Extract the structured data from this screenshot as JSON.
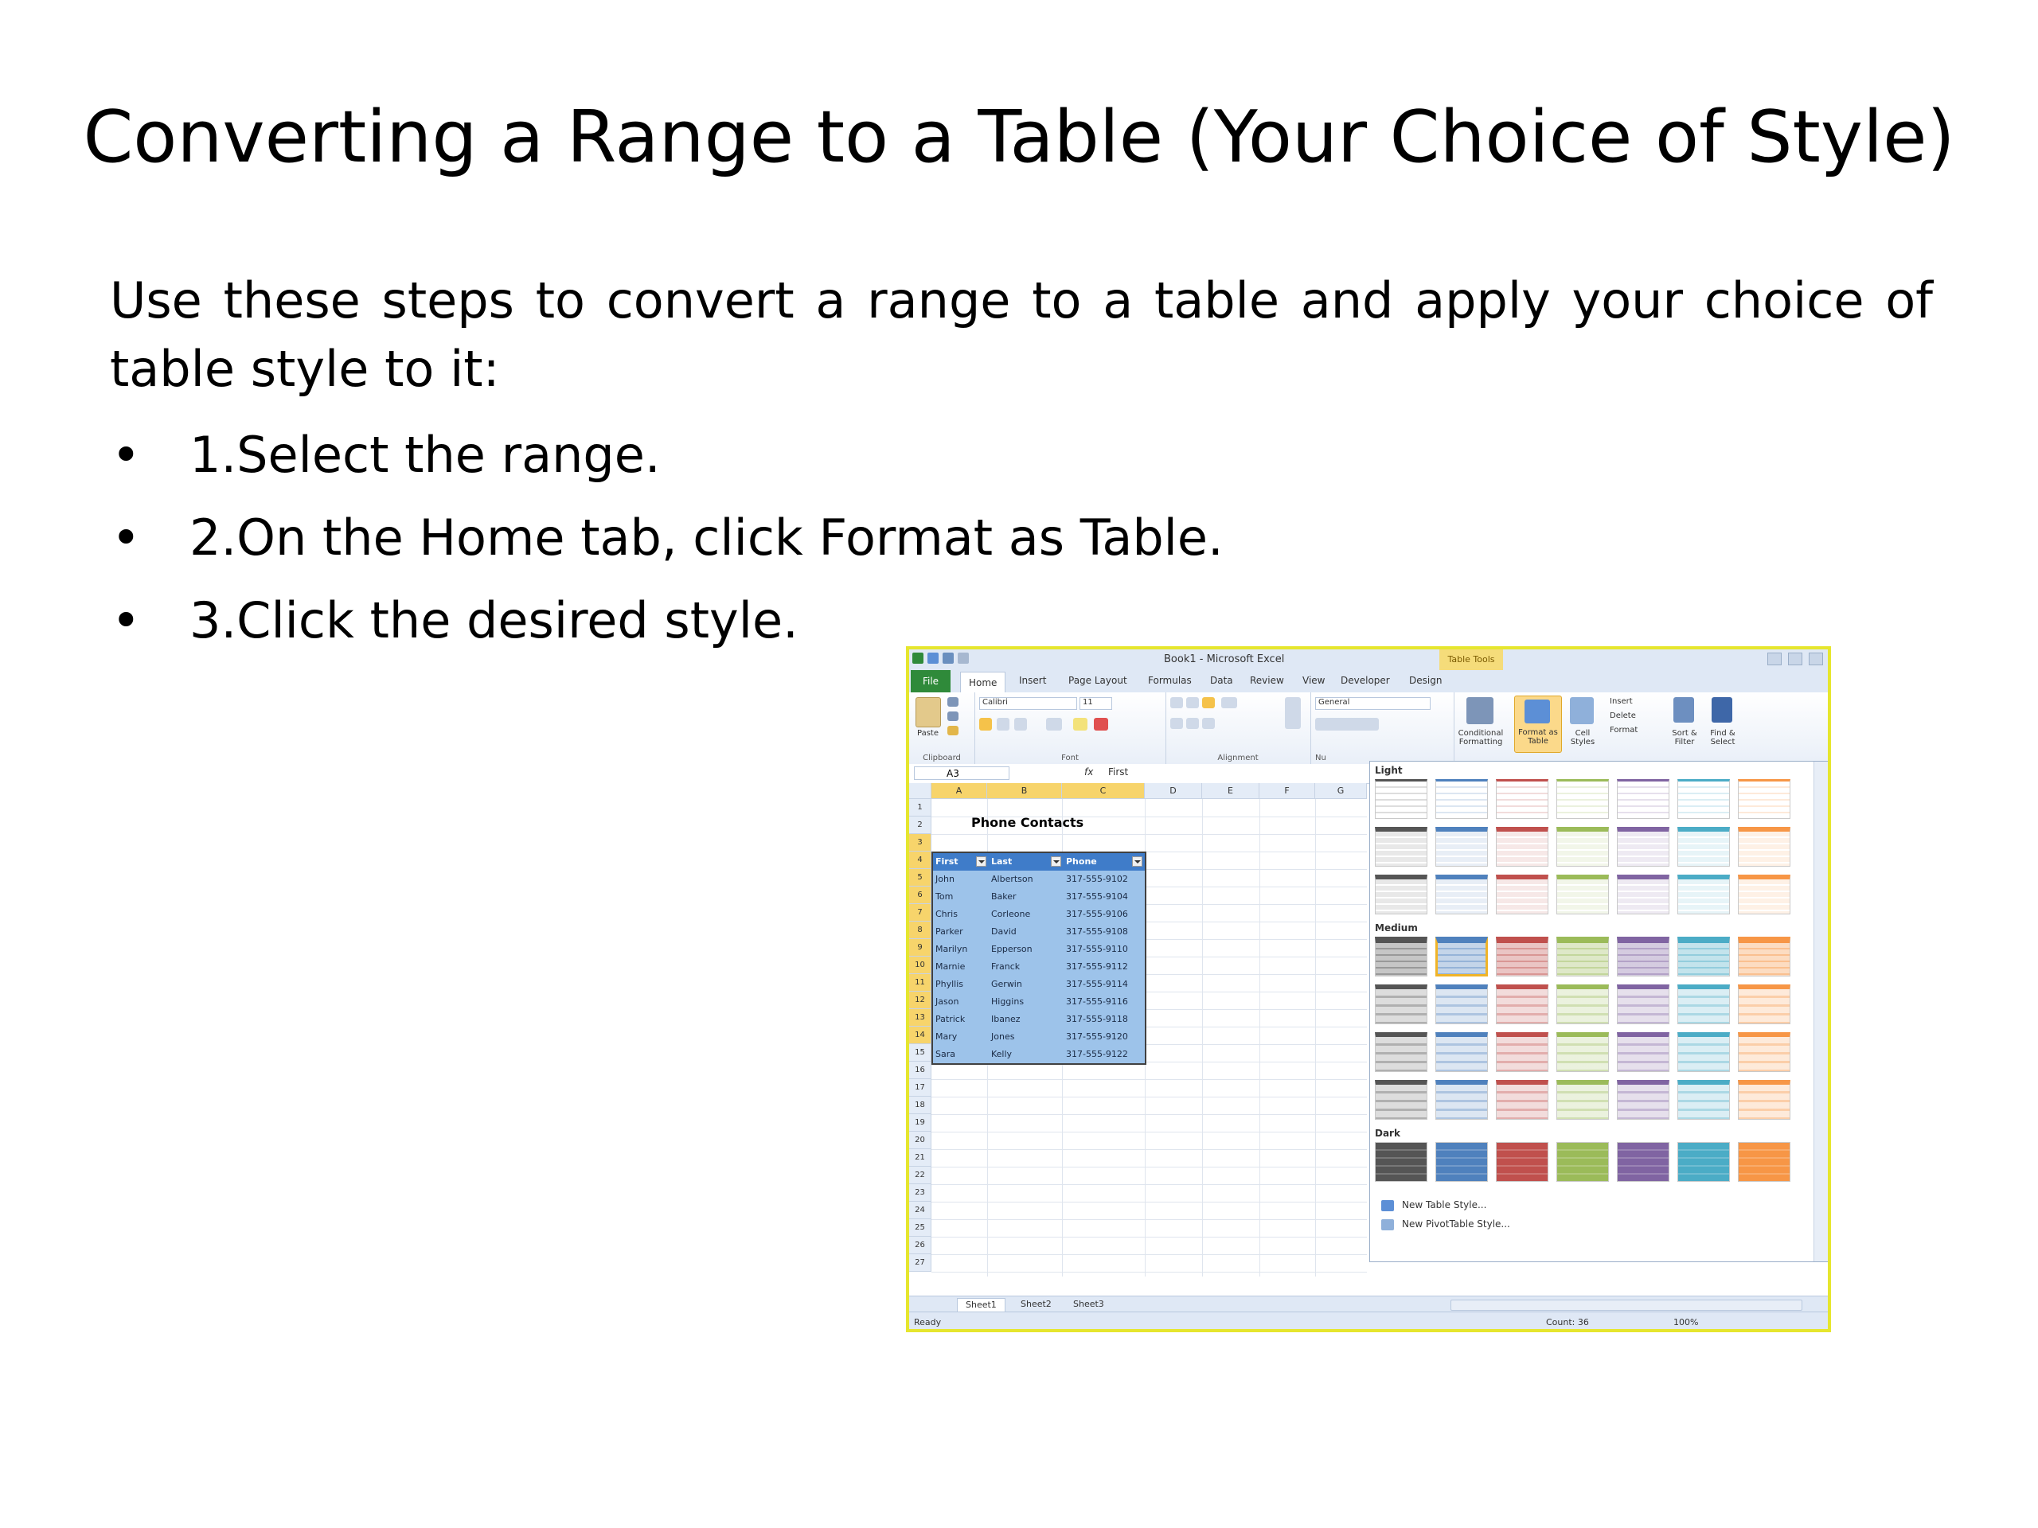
{
  "slide": {
    "title": "Converting a Range to a Table (Your Choice of Style)",
    "intro": "Use these steps to convert a range to a table and apply your choice of table style to it:",
    "steps": [
      "1.Select the range.",
      "2.On the Home tab, click Format as Table.",
      "3.Click the desired style."
    ]
  },
  "excel": {
    "window_title": "Book1 - Microsoft Excel",
    "table_tools": "Table Tools",
    "tabs": [
      "File",
      "Home",
      "Insert",
      "Page Layout",
      "Formulas",
      "Data",
      "Review",
      "View",
      "Developer",
      "Design"
    ],
    "ribbon": {
      "paste": "Paste",
      "font_name": "Calibri",
      "font_size": "11",
      "number_format": "General",
      "conditional_formatting": "Conditional Formatting",
      "format_as_table": "Format as Table",
      "cell_styles": "Cell Styles",
      "insert": "Insert",
      "delete": "Delete",
      "format": "Format",
      "sort_filter": "Sort & Filter",
      "find_select": "Find & Select",
      "groups": [
        "Clipboard",
        "Font",
        "Alignment",
        "Nu"
      ]
    },
    "formula_bar": {
      "name_box": "A3",
      "fx": "fx",
      "value": "First"
    },
    "columns": [
      "A",
      "B",
      "C",
      "D",
      "E",
      "F",
      "G"
    ],
    "sheet_title": "Phone Contacts",
    "table": {
      "headers": [
        "First",
        "Last",
        "Phone"
      ],
      "rows": [
        [
          "John",
          "Albertson",
          "317-555-9102"
        ],
        [
          "Tom",
          "Baker",
          "317-555-9104"
        ],
        [
          "Chris",
          "Corleone",
          "317-555-9106"
        ],
        [
          "Parker",
          "David",
          "317-555-9108"
        ],
        [
          "Marilyn",
          "Epperson",
          "317-555-9110"
        ],
        [
          "Marnie",
          "Franck",
          "317-555-9112"
        ],
        [
          "Phyllis",
          "Gerwin",
          "317-555-9114"
        ],
        [
          "Jason",
          "Higgins",
          "317-555-9116"
        ],
        [
          "Patrick",
          "Ibanez",
          "317-555-9118"
        ],
        [
          "Mary",
          "Jones",
          "317-555-9120"
        ],
        [
          "Sara",
          "Kelly",
          "317-555-9122"
        ]
      ]
    },
    "gallery": {
      "sections": [
        "Light",
        "Medium",
        "Dark"
      ],
      "colors": [
        "#555555",
        "#4f81bd",
        "#c0504d",
        "#9bbb59",
        "#8064a2",
        "#4bacc6",
        "#f79646"
      ],
      "new_table_style": "New Table Style...",
      "new_pivot_style": "New PivotTable Style..."
    },
    "sheet_tabs": [
      "Sheet1",
      "Sheet2",
      "Sheet3"
    ],
    "status": {
      "ready": "Ready",
      "count": "Count: 36",
      "zoom": "100%"
    }
  }
}
